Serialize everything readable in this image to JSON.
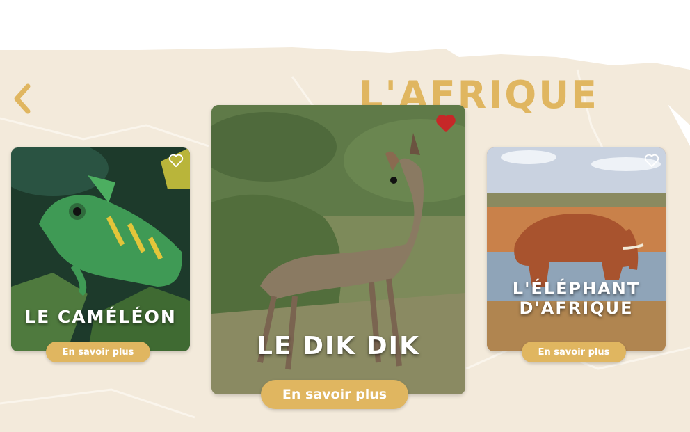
{
  "region": {
    "title": "L'AFRIQUE"
  },
  "navigation": {
    "back_icon": "chevron-left-icon"
  },
  "colors": {
    "accent": "#e0b660",
    "map_background": "#f3eadb",
    "favorite_active": "#c62828",
    "button_text": "#ffffff"
  },
  "cards": [
    {
      "name": "LE CAMÉLÉON",
      "button_label": "En savoir plus",
      "favorite": false,
      "favorite_icon": "heart-outline-icon"
    },
    {
      "name": "LE DIK DIK",
      "button_label": "En savoir plus",
      "favorite": true,
      "favorite_icon": "heart-filled-icon"
    },
    {
      "name": "L'ÉLÉPHANT\nD'AFRIQUE",
      "button_label": "En savoir plus",
      "favorite": false,
      "favorite_icon": "heart-outline-icon"
    }
  ]
}
